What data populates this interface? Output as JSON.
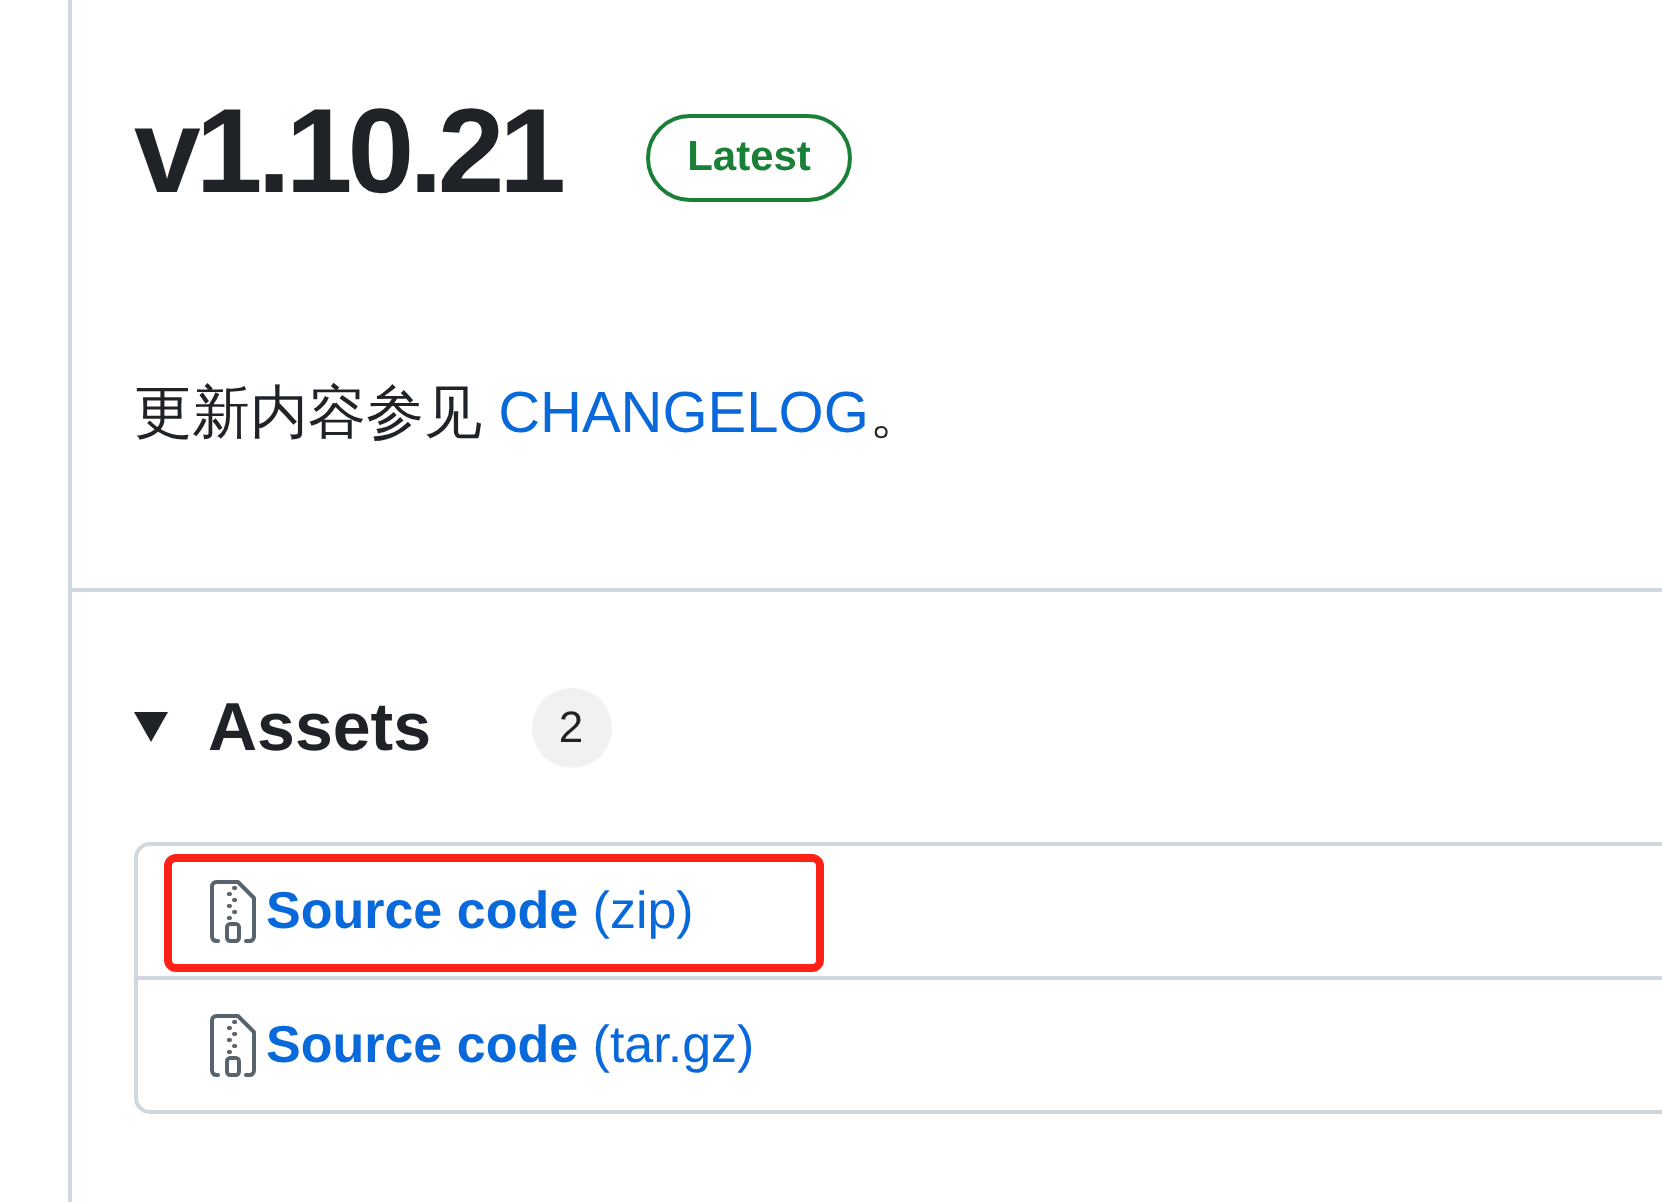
{
  "release": {
    "title": "v1.10.21",
    "badge": "Latest"
  },
  "notes": {
    "text": "更新内容参见 ",
    "link": "CHANGELOG",
    "after": "。"
  },
  "assets": {
    "title": "Assets",
    "count": "2",
    "expanded": true,
    "items": [
      {
        "label": "**Source code** (zip)",
        "highlighted": true
      },
      {
        "label": "**Source code** (tar.gz)",
        "highlighted": false
      }
    ]
  }
}
